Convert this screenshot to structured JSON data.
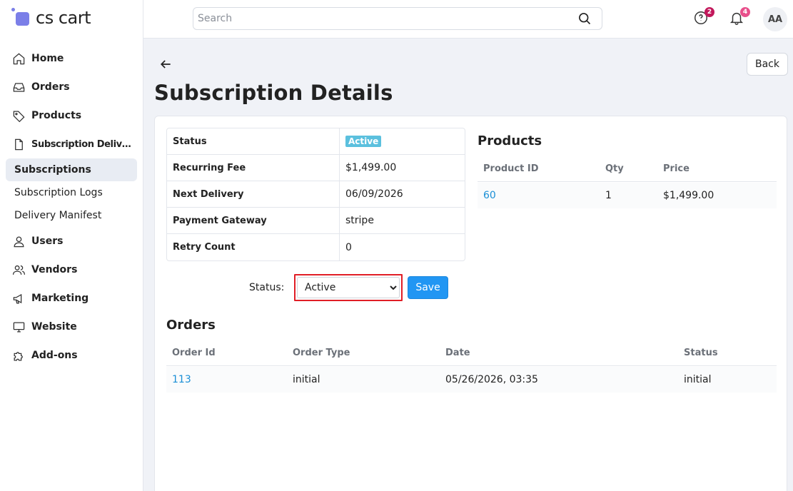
{
  "app": {
    "logo_text": "cs cart"
  },
  "sidebar": {
    "items": [
      {
        "label": "Home",
        "icon": "home-icon"
      },
      {
        "label": "Orders",
        "icon": "inbox-icon"
      },
      {
        "label": "Products",
        "icon": "tag-icon"
      },
      {
        "label": "Subscription Delivery ...",
        "icon": "document-icon"
      }
    ],
    "subitems": [
      {
        "label": "Subscriptions",
        "active": true
      },
      {
        "label": "Subscription Logs",
        "active": false
      },
      {
        "label": "Delivery Manifest",
        "active": false
      }
    ],
    "items2": [
      {
        "label": "Users",
        "icon": "user-icon"
      },
      {
        "label": "Vendors",
        "icon": "users-icon"
      },
      {
        "label": "Marketing",
        "icon": "megaphone-icon"
      },
      {
        "label": "Website",
        "icon": "monitor-icon"
      },
      {
        "label": "Add-ons",
        "icon": "puzzle-icon"
      }
    ]
  },
  "header": {
    "search_placeholder": "Search",
    "help_badge": "2",
    "notifications_badge": "4",
    "avatar_initials": "AA",
    "help_badge_color": "#c2185b",
    "notifications_badge_color": "#e84f8b"
  },
  "page": {
    "title": "Subscription Details",
    "back_label": "Back"
  },
  "details": {
    "rows": [
      {
        "key": "Status",
        "value": "Active",
        "is_badge": true
      },
      {
        "key": "Recurring Fee",
        "value": "$1,499.00"
      },
      {
        "key": "Next Delivery",
        "value": "06/09/2026"
      },
      {
        "key": "Payment Gateway",
        "value": "stripe"
      },
      {
        "key": "Retry Count",
        "value": "0"
      }
    ],
    "badge_color": "#5bc0de"
  },
  "status_form": {
    "label": "Status:",
    "selected": "Active",
    "save_label": "Save"
  },
  "products": {
    "title": "Products",
    "headers": [
      "Product ID",
      "Qty",
      "Price"
    ],
    "rows": [
      {
        "product_id": "60",
        "qty": "1",
        "price": "$1,499.00"
      }
    ]
  },
  "orders": {
    "title": "Orders",
    "headers": [
      "Order Id",
      "Order Type",
      "Date",
      "Status"
    ],
    "rows": [
      {
        "order_id": "113",
        "order_type": "initial",
        "date": "05/26/2026, 03:35",
        "status": "initial"
      }
    ]
  },
  "colors": {
    "accent": "#2196f3",
    "link": "#1a8fd6",
    "highlight": "#e01e26"
  }
}
